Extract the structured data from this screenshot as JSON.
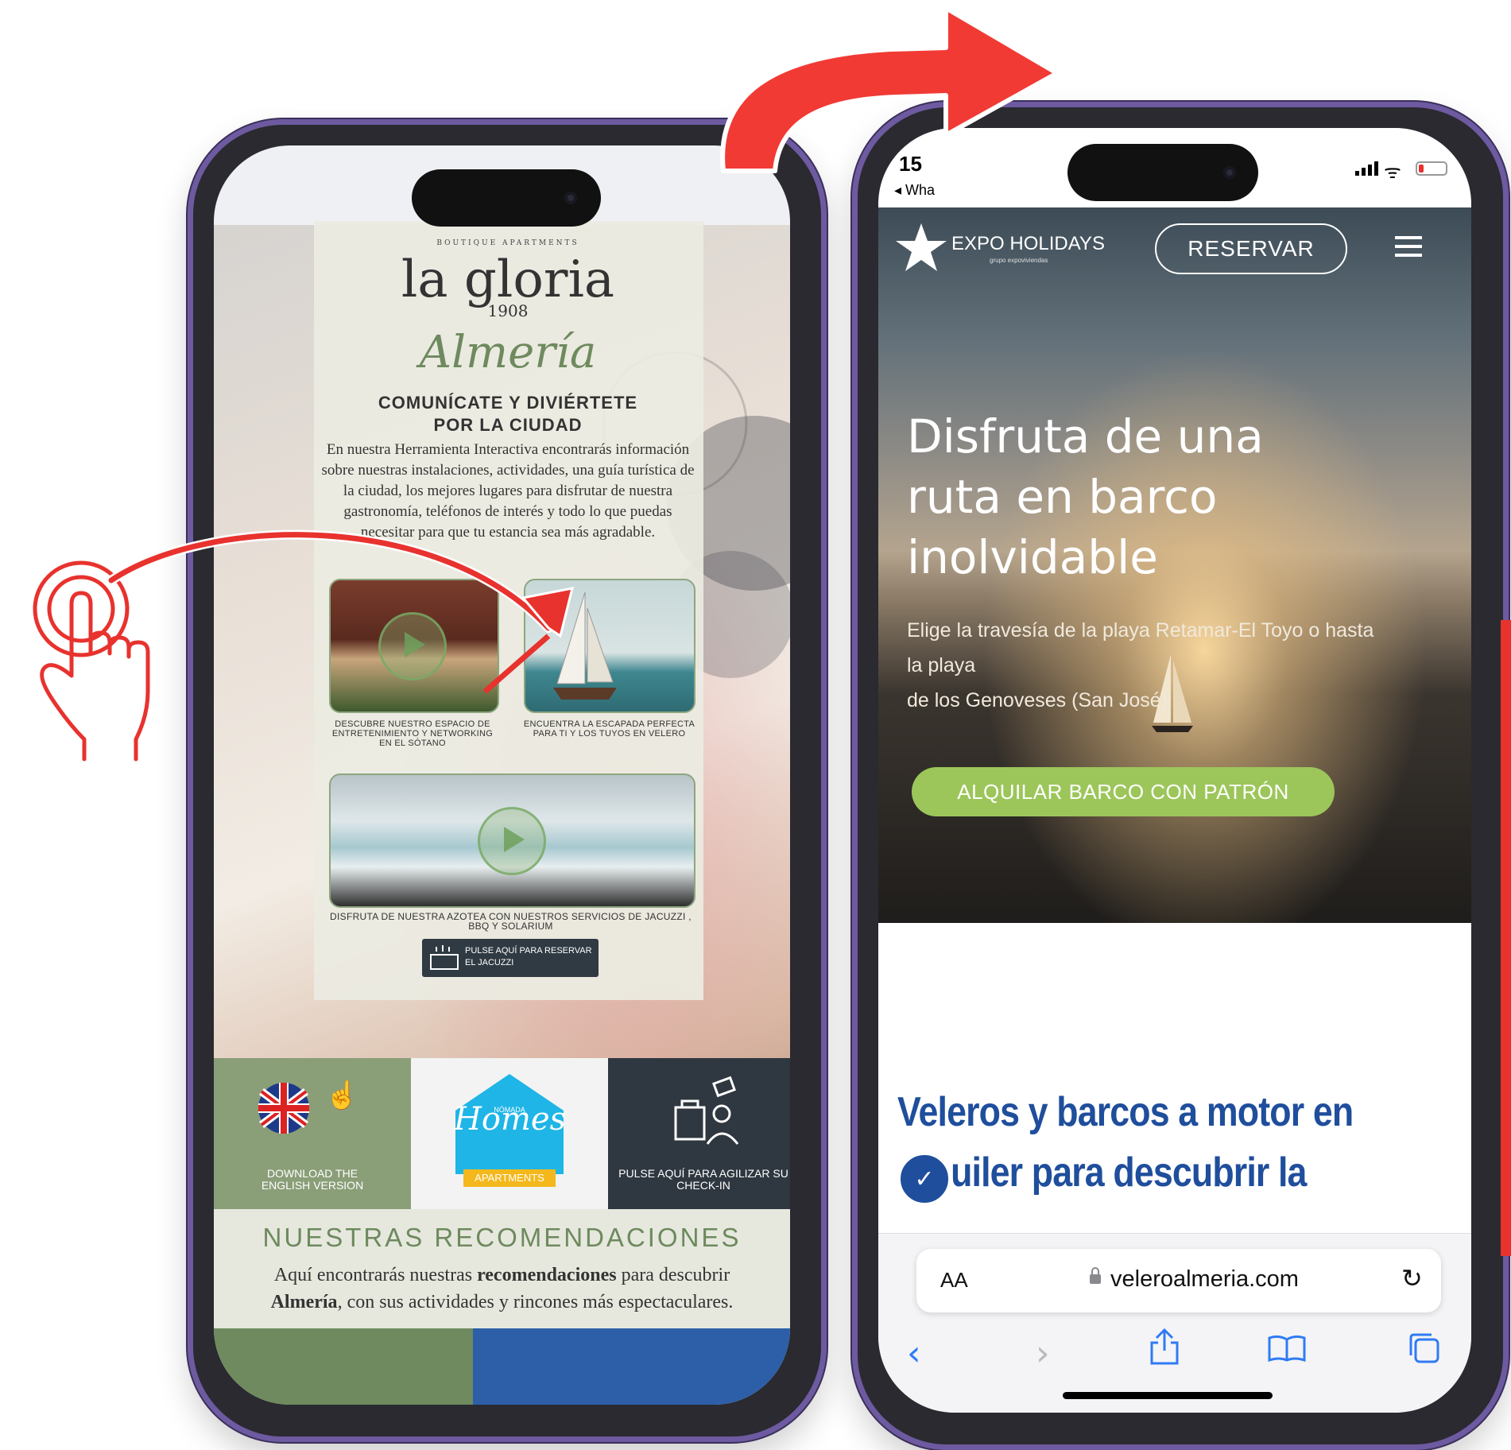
{
  "left_phone": {
    "brand_small": "BOUTIQUE APARTMENTS",
    "brand_name": "la gloria",
    "brand_year": "1908",
    "city_script": "Almería",
    "heading_line1": "COMUNÍCATE Y DIVIÉRTETE",
    "heading_line2": "POR LA CIUDAD",
    "intro_text": "En nuestra Herramienta Interactiva encontrarás información sobre nuestras instalaciones, actividades, una guía turística de la ciudad, los mejores lugares para disfrutar de nuestra gastronomía, teléfonos de interés y todo lo que puedas necesitar para que tu estancia sea más agradable.",
    "caption_basement": "DESCUBRE NUESTRO ESPACIO DE ENTRETENIMIENTO Y NETWORKING EN EL SÓTANO",
    "caption_sailboat": "ENCUENTRA LA ESCAPADA PERFECTA PARA TI Y LOS TUYOS EN VELERO",
    "caption_rooftop": "DISFRUTA DE NUESTRA AZOTEA CON NUESTROS SERVICIOS DE JACUZZI , BBQ Y SOLARIUM",
    "jacuzzi_button": "PULSE AQUÍ PARA RESERVAR EL JACUZZI",
    "tile_english": "DOWNLOAD THE ENGLISH VERSION",
    "tile_homes_top": "NÓMADA",
    "tile_homes_main": "Homes",
    "tile_homes_sub": "APARTMENTS",
    "tile_checkin": "PULSE AQUÍ PARA AGILIZAR SU CHECK-IN",
    "recommendations_title": "NUESTRAS RECOMENDACIONES",
    "recommendations_text_a": "Aquí encontrarás nuestras ",
    "recommendations_text_b": "recomendaciones",
    "recommendations_text_c": " para descubrir ",
    "recommendations_text_d": "Almería",
    "recommendations_text_e": ", con sus actividades y rincones más espectaculares."
  },
  "right_phone": {
    "status_time": "15",
    "status_back": "◂ Wha",
    "logo_text": "EXPO HOLIDAYS",
    "logo_sub": "grupo expoviviendas",
    "reserve_button": "RESERVAR",
    "hero_title_line1": "Disfruta de una",
    "hero_title_line2": "ruta en barco",
    "hero_title_line3": "inolvidable",
    "hero_sub_line1": "Elige la travesía de la playa Retamar-El Toyo o hasta",
    "hero_sub_line2": "la playa",
    "hero_sub_line3": "de los Genoveses (San José)",
    "cta_button": "ALQUILAR BARCO CON PATRÓN",
    "section_heading_line1": "Veleros y barcos a motor en",
    "section_heading_line2": "uiler para descubrir la",
    "text_size_label": "AA",
    "url": "veleroalmeria.com"
  },
  "colors": {
    "accent_red": "#e8322e",
    "green_button": "#9cc65a",
    "navy_heading": "#1f4e9c",
    "safari_blue": "#2f7bf5",
    "phone_frame": "#6d5aa0"
  },
  "icons": [
    "tap-hand-icon",
    "curved-arrow-icon",
    "play-icon",
    "uk-flag-icon",
    "concierge-icon",
    "menu-icon",
    "lock-icon",
    "reload-icon",
    "back-icon",
    "forward-icon",
    "share-icon",
    "bookmarks-icon",
    "tabs-icon",
    "chat-icon"
  ]
}
